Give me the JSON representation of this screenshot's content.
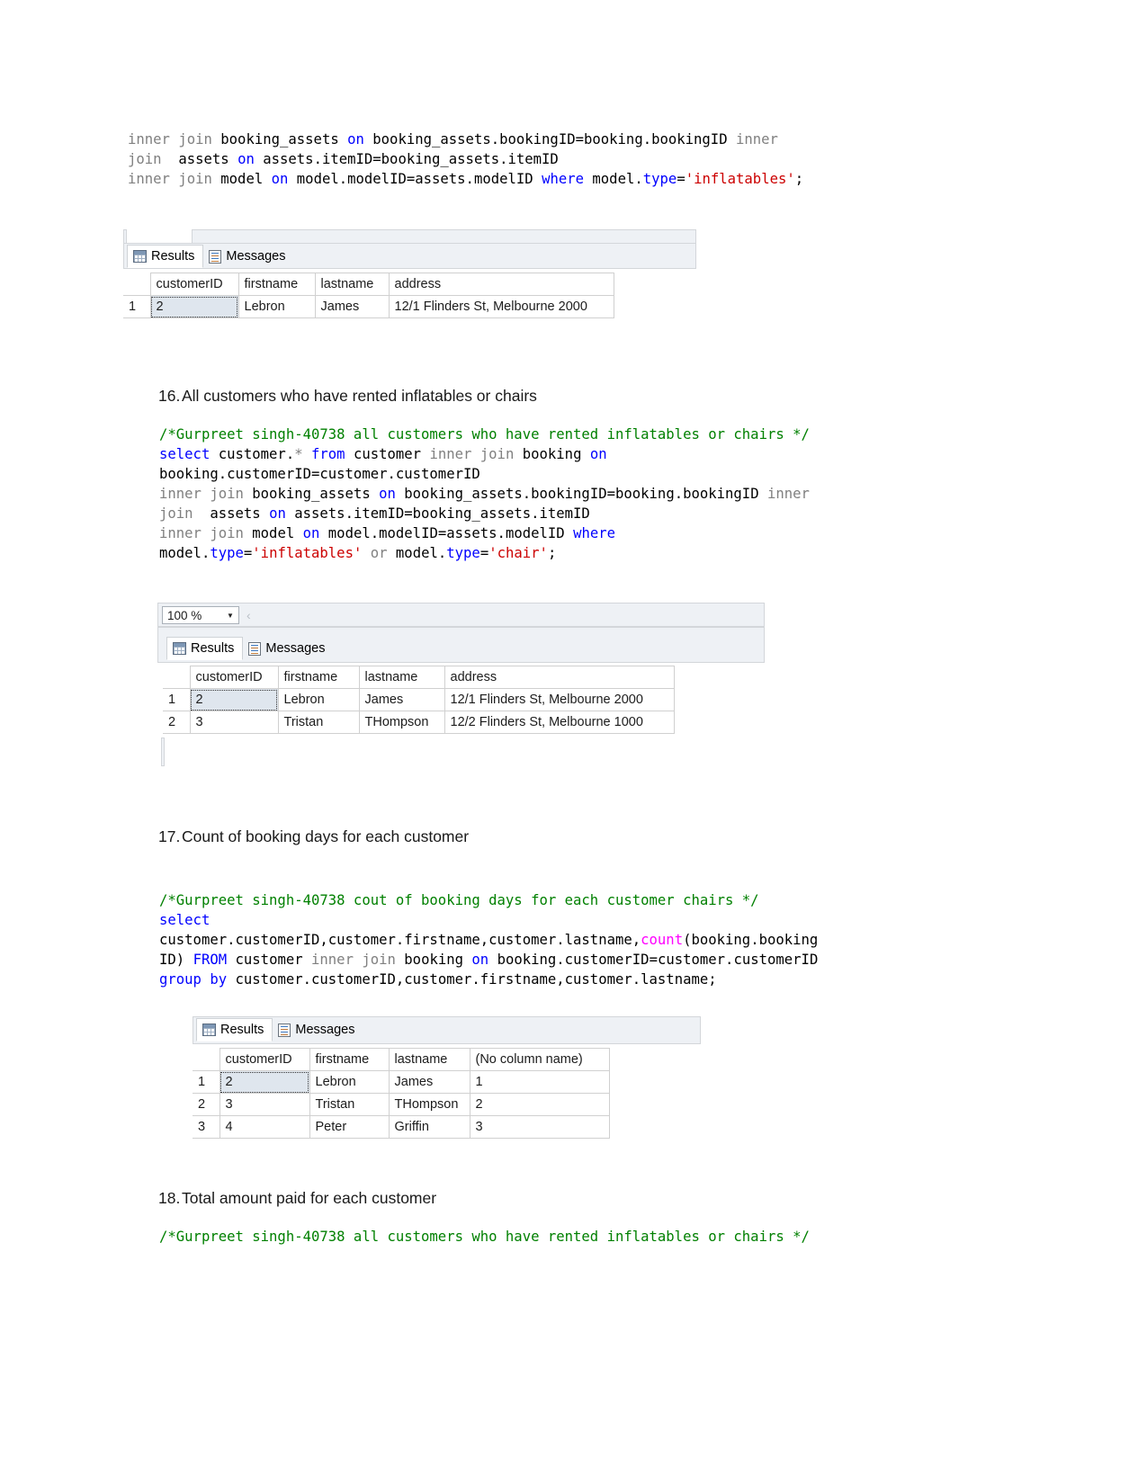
{
  "document": {
    "top_code": {
      "lines": [
        [
          {
            "t": "inner join ",
            "c": "grey"
          },
          {
            "t": "booking_assets ",
            "c": "plain"
          },
          {
            "t": "on ",
            "c": "kw"
          },
          {
            "t": "booking_assets.bookingID=booking.bookingID ",
            "c": "plain"
          },
          {
            "t": "inner",
            "c": "grey"
          }
        ],
        [
          {
            "t": "join  ",
            "c": "grey"
          },
          {
            "t": "assets ",
            "c": "plain"
          },
          {
            "t": "on ",
            "c": "kw"
          },
          {
            "t": "assets.itemID=booking_assets.itemID",
            "c": "plain"
          }
        ],
        [
          {
            "t": "inner join ",
            "c": "grey"
          },
          {
            "t": "model ",
            "c": "plain"
          },
          {
            "t": "on ",
            "c": "kw"
          },
          {
            "t": "model.modelID=assets.modelID ",
            "c": "plain"
          },
          {
            "t": "where ",
            "c": "kw"
          },
          {
            "t": "model.",
            "c": "plain"
          },
          {
            "t": "type",
            "c": "kw"
          },
          {
            "t": "=",
            "c": "plain"
          },
          {
            "t": "'inflatables'",
            "c": "str"
          },
          {
            "t": ";",
            "c": "plain"
          }
        ]
      ]
    },
    "result_pane_1": {
      "tabs": [
        {
          "label": "Results",
          "icon": "grid-icon",
          "active": true
        },
        {
          "label": "Messages",
          "icon": "message-icon",
          "active": false
        }
      ],
      "columns": [
        "",
        "customerID",
        "firstname",
        "lastname",
        "address"
      ],
      "rows": [
        [
          "1",
          "2",
          "Lebron",
          "James",
          "12/1 Flinders St, Melbourne 2000"
        ]
      ]
    },
    "section16": {
      "number": "16.",
      "title": "All customers who have rented inflatables or chairs",
      "code_lines": [
        [
          {
            "t": "/*Gurpreet singh-40738 all customers who have rented inflatables or chairs */",
            "c": "cmt"
          }
        ],
        [
          {
            "t": "select ",
            "c": "kw"
          },
          {
            "t": "customer.",
            "c": "plain"
          },
          {
            "t": "*",
            "c": "grey"
          },
          {
            "t": " ",
            "c": "plain"
          },
          {
            "t": "from ",
            "c": "kw"
          },
          {
            "t": "customer ",
            "c": "plain"
          },
          {
            "t": "inner join ",
            "c": "grey"
          },
          {
            "t": "booking ",
            "c": "plain"
          },
          {
            "t": "on",
            "c": "kw"
          }
        ],
        [
          {
            "t": "booking.customerID=customer.customerID",
            "c": "plain"
          }
        ],
        [
          {
            "t": "inner join ",
            "c": "grey"
          },
          {
            "t": "booking_assets ",
            "c": "plain"
          },
          {
            "t": "on ",
            "c": "kw"
          },
          {
            "t": "booking_assets.bookingID=booking.bookingID ",
            "c": "plain"
          },
          {
            "t": "inner",
            "c": "grey"
          }
        ],
        [
          {
            "t": "join  ",
            "c": "grey"
          },
          {
            "t": "assets ",
            "c": "plain"
          },
          {
            "t": "on ",
            "c": "kw"
          },
          {
            "t": "assets.itemID=booking_assets.itemID",
            "c": "plain"
          }
        ],
        [
          {
            "t": "inner join ",
            "c": "grey"
          },
          {
            "t": "model ",
            "c": "plain"
          },
          {
            "t": "on ",
            "c": "kw"
          },
          {
            "t": "model.modelID=assets.modelID ",
            "c": "plain"
          },
          {
            "t": "where",
            "c": "kw"
          }
        ],
        [
          {
            "t": "model.",
            "c": "plain"
          },
          {
            "t": "type",
            "c": "kw"
          },
          {
            "t": "=",
            "c": "plain"
          },
          {
            "t": "'inflatables'",
            "c": "str"
          },
          {
            "t": " or ",
            "c": "grey"
          },
          {
            "t": "model.",
            "c": "plain"
          },
          {
            "t": "type",
            "c": "kw"
          },
          {
            "t": "=",
            "c": "plain"
          },
          {
            "t": "'chair'",
            "c": "str"
          },
          {
            "t": ";",
            "c": "plain"
          }
        ]
      ],
      "result_pane": {
        "zoom_value": "100 %",
        "tabs": [
          {
            "label": "Results",
            "icon": "grid-icon",
            "active": true
          },
          {
            "label": "Messages",
            "icon": "message-icon",
            "active": false
          }
        ],
        "columns": [
          "",
          "customerID",
          "firstname",
          "lastname",
          "address"
        ],
        "rows": [
          [
            "1",
            "2",
            "Lebron",
            "James",
            "12/1 Flinders St, Melbourne 2000"
          ],
          [
            "2",
            "3",
            "Tristan",
            "THompson",
            "12/2 Flinders St, Melbourne 1000"
          ]
        ]
      }
    },
    "section17": {
      "number": "17.",
      "title": "Count of booking days for each customer",
      "code_lines": [
        [
          {
            "t": "/*Gurpreet singh-40738 cout of booking days for each customer chairs */",
            "c": "cmt"
          }
        ],
        [
          {
            "t": "select",
            "c": "kw"
          }
        ],
        [
          {
            "t": "customer.customerID,customer.firstname,customer.lastname,",
            "c": "plain"
          },
          {
            "t": "count",
            "c": "fn"
          },
          {
            "t": "(booking.booking",
            "c": "plain"
          }
        ],
        [
          {
            "t": "ID) ",
            "c": "plain"
          },
          {
            "t": "FROM ",
            "c": "kw"
          },
          {
            "t": "customer ",
            "c": "plain"
          },
          {
            "t": "inner join ",
            "c": "grey"
          },
          {
            "t": "booking ",
            "c": "plain"
          },
          {
            "t": "on ",
            "c": "kw"
          },
          {
            "t": "booking.customerID=customer.customerID",
            "c": "plain"
          }
        ],
        [
          {
            "t": "group by ",
            "c": "kw"
          },
          {
            "t": "customer.customerID,customer.firstname,customer.lastname;",
            "c": "plain"
          }
        ]
      ],
      "result_pane": {
        "tabs": [
          {
            "label": "Results",
            "icon": "grid-icon",
            "active": true
          },
          {
            "label": "Messages",
            "icon": "message-icon",
            "active": false
          }
        ],
        "columns": [
          "",
          "customerID",
          "firstname",
          "lastname",
          "(No column name)"
        ],
        "rows": [
          [
            "1",
            "2",
            "Lebron",
            "James",
            "1"
          ],
          [
            "2",
            "3",
            "Tristan",
            "THompson",
            "2"
          ],
          [
            "3",
            "4",
            "Peter",
            "Griffin",
            "3"
          ]
        ]
      }
    },
    "section18": {
      "number": "18.",
      "title": "Total amount paid for each customer",
      "code_lines": [
        [
          {
            "t": "/*Gurpreet singh-40738 all customers who have rented inflatables or chairs */",
            "c": "cmt"
          }
        ]
      ]
    }
  }
}
